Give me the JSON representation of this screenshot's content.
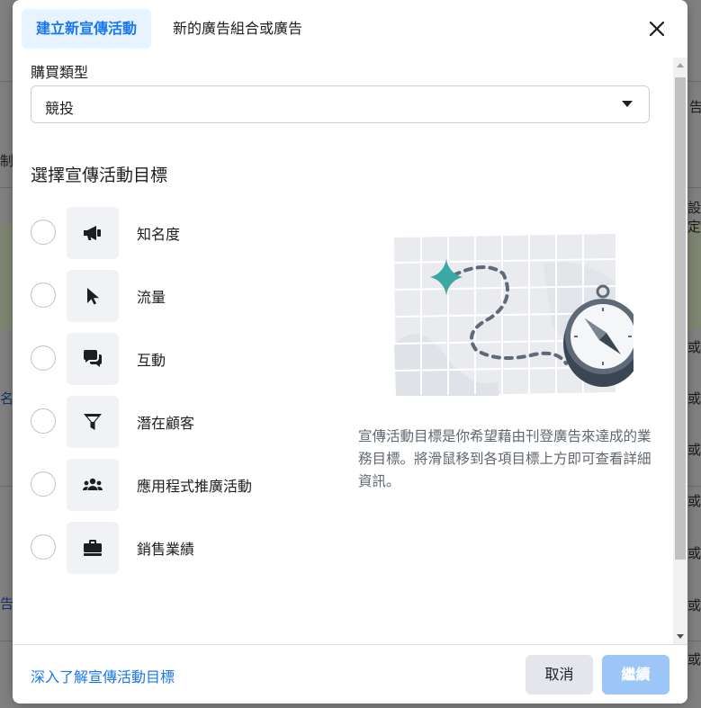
{
  "tabs": [
    {
      "label": "建立新宣傳活動"
    },
    {
      "label": "新的廣告組合或廣告"
    }
  ],
  "buying_type": {
    "label": "購買類型",
    "value": "競投"
  },
  "objectives": {
    "title": "選擇宣傳活動目標",
    "items": [
      {
        "label": "知名度",
        "icon": "megaphone-icon"
      },
      {
        "label": "流量",
        "icon": "cursor-icon"
      },
      {
        "label": "互動",
        "icon": "chat-bubbles-icon"
      },
      {
        "label": "潛在顧客",
        "icon": "funnel-icon"
      },
      {
        "label": "應用程式推廣活動",
        "icon": "people-icon"
      },
      {
        "label": "銷售業績",
        "icon": "briefcase-icon"
      }
    ],
    "description": "宣傳活動目標是你希望藉由刊登廣告來達成的業務目標。將滑鼠移到各項目標上方即可查看詳細資訊。"
  },
  "footer": {
    "learn_more": "深入了解宣傳活動目標",
    "cancel": "取消",
    "continue": "繼續"
  },
  "background": {
    "fragments": [
      "告",
      "制",
      "設定",
      "名",
      "或",
      "或",
      "或",
      "或",
      "告",
      "或",
      "或",
      "或"
    ]
  },
  "colors": {
    "accent": "#1877f2",
    "accent_light": "#e7f3ff",
    "continue_disabled": "#9cc6f7",
    "teal_star": "#3aa8a4"
  }
}
